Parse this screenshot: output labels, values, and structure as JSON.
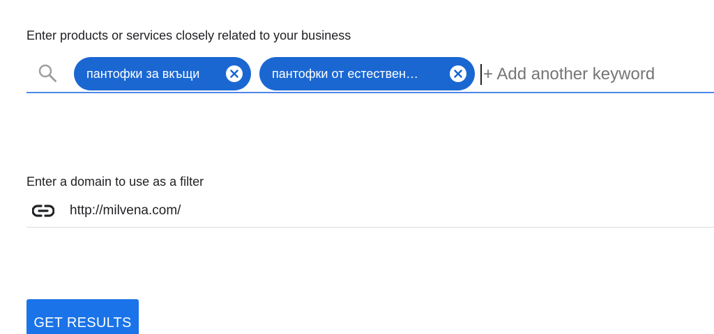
{
  "keywords_section": {
    "label": "Enter products or services closely related to your business",
    "search_icon": "search-icon",
    "chips": [
      {
        "label": "пантофки за вкъщи",
        "remove_icon": "close-circle-icon"
      },
      {
        "label": "пантофки от естествен…",
        "remove_icon": "close-circle-icon"
      }
    ],
    "input_placeholder": "+ Add another keyword",
    "input_value": ""
  },
  "domain_section": {
    "label": "Enter a domain to use as a filter",
    "link_icon": "link-icon",
    "input_value": "http://milvena.com/"
  },
  "actions": {
    "get_results_label": "GET RESULTS"
  },
  "colors": {
    "chip_background": "#1a67d2",
    "input_underline_active": "#4a86e8",
    "input_underline": "#dadce0",
    "button_background": "#1a73e8",
    "placeholder": "#757575",
    "search_icon": "#9e9e9e"
  }
}
